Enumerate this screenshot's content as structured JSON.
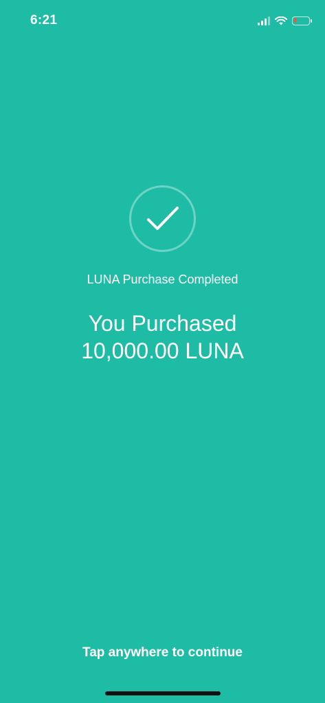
{
  "status_bar": {
    "time": "6:21",
    "battery_color": "#E85C4A",
    "icons": [
      "signal-icon",
      "wifi-icon",
      "battery-icon"
    ]
  },
  "main": {
    "background_color": "#1FBCA5",
    "icon": "checkmark-icon",
    "subtitle": "LUNA Purchase Completed",
    "headline_line1": "You Purchased",
    "headline_line2": "10,000.00 LUNA"
  },
  "footer": {
    "continue_label": "Tap anywhere to continue"
  }
}
